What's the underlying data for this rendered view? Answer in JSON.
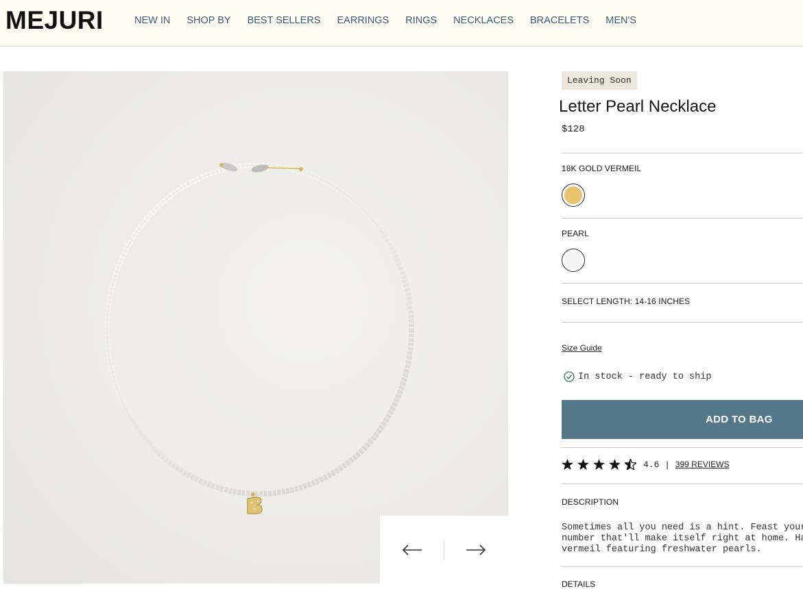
{
  "header": {
    "logo": "MEJURI",
    "nav": [
      "NEW IN",
      "SHOP BY",
      "BEST SELLERS",
      "EARRINGS",
      "RINGS",
      "NECKLACES",
      "BRACELETS",
      "MEN'S"
    ]
  },
  "product": {
    "badge": "Leaving Soon",
    "title": "Letter Pearl Necklace",
    "price": "$128",
    "metal_label": "18K GOLD VERMEIL",
    "metal_color": "#e9c46d",
    "stone_label": "PEARL",
    "stone_color": "#f4f4f4",
    "length_label": "SELECT LENGTH: 14-16 INCHES",
    "size_guide": "Size Guide",
    "stock": "In stock - ready to ship",
    "add_to_bag": "ADD TO BAG",
    "rating_value": "4.6",
    "rating_sep": "|",
    "reviews": "399 REVIEWS",
    "description_label": "DESCRIPTION",
    "description": "Sometimes all you need is a hint. Feast your\nnumber that'll make itself right at home. Ha\nvermeil featuring freshwater pearls.",
    "details_label": "DETAILS"
  },
  "colors": {
    "accent": "#54778a",
    "nav": "#3d5a73",
    "stock_check": "#2e7d4f"
  }
}
